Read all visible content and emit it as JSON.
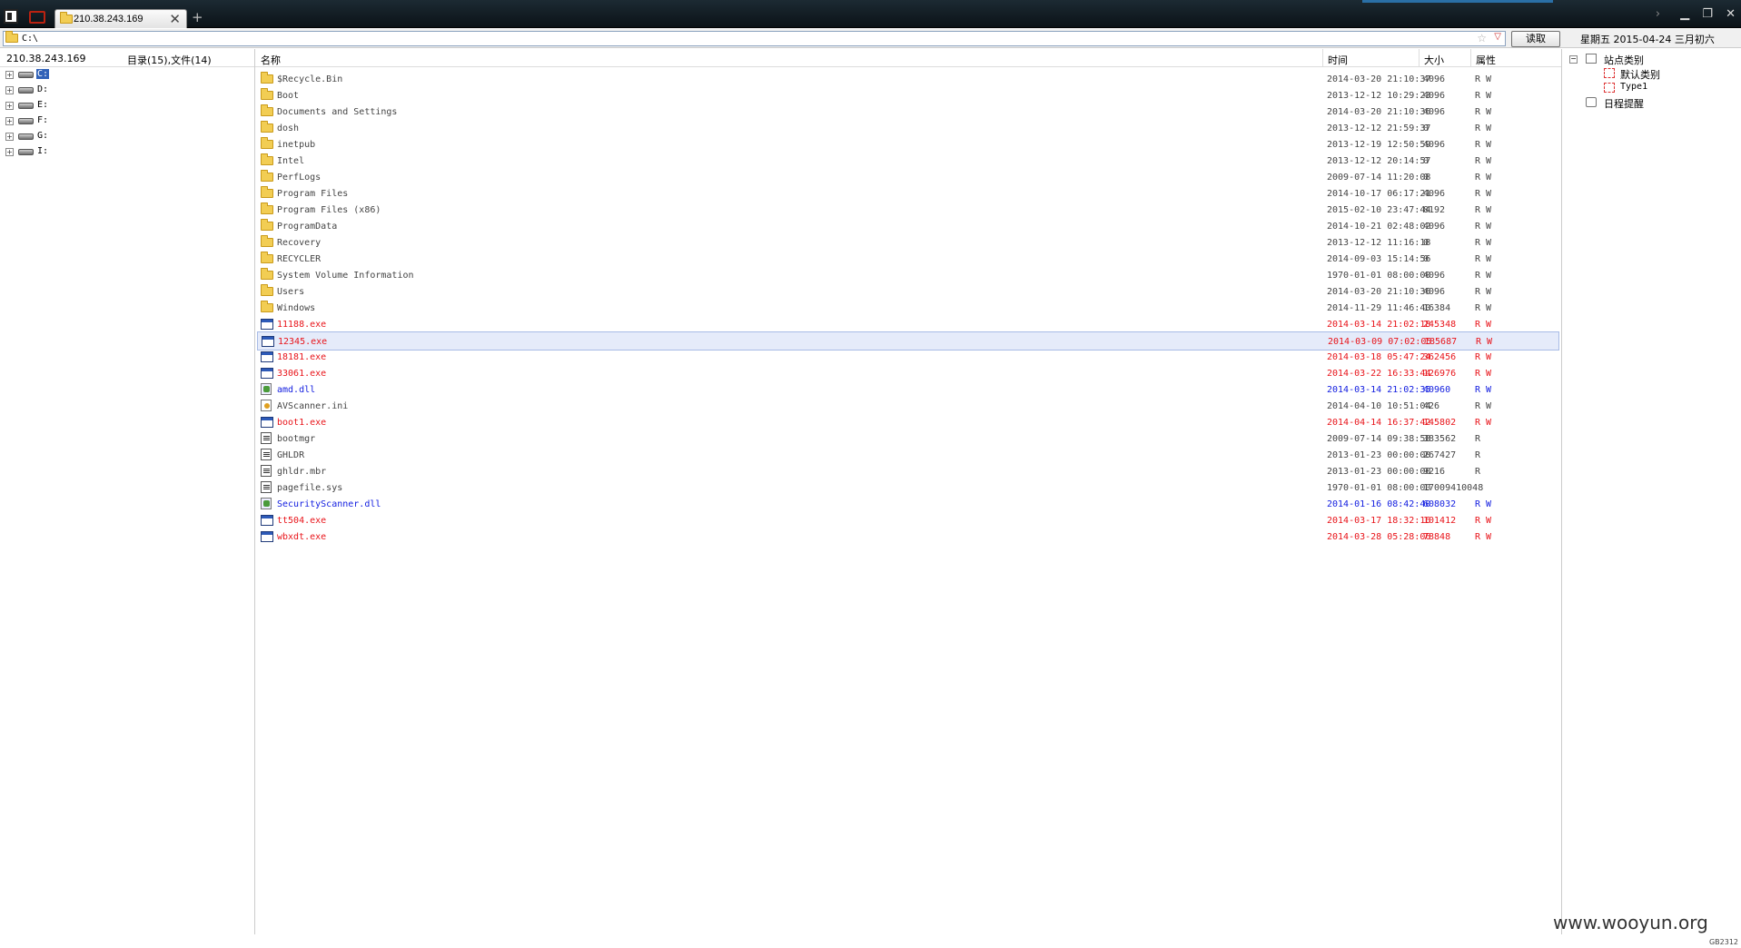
{
  "tab": {
    "title": "210.38.243.169"
  },
  "address": {
    "path": "C:\\",
    "read_button": "读取"
  },
  "date_info": "星期五 2015-04-24 三月初六",
  "left_panel": {
    "host": "210.38.243.169",
    "count": "目录(15),文件(14)",
    "drives": [
      "C:",
      "D:",
      "E:",
      "F:",
      "G:",
      "I:"
    ],
    "selected_drive": "C:"
  },
  "columns": {
    "name": "名称",
    "time": "时间",
    "size": "大小",
    "attr": "属性"
  },
  "files": [
    {
      "name": "$Recycle.Bin",
      "time": "2014-03-20 21:10:37",
      "size": "4096",
      "attr": "R W",
      "icon": "folder",
      "color": "black"
    },
    {
      "name": "Boot",
      "time": "2013-12-12 10:29:23",
      "size": "4096",
      "attr": "R W",
      "icon": "folder",
      "color": "black"
    },
    {
      "name": "Documents and Settings",
      "time": "2014-03-20 21:10:36",
      "size": "4096",
      "attr": "R W",
      "icon": "folder",
      "color": "black"
    },
    {
      "name": "dosh",
      "time": "2013-12-12 21:59:37",
      "size": "0",
      "attr": "R W",
      "icon": "folder",
      "color": "black"
    },
    {
      "name": "inetpub",
      "time": "2013-12-19 12:50:59",
      "size": "4096",
      "attr": "R W",
      "icon": "folder",
      "color": "black"
    },
    {
      "name": "Intel",
      "time": "2013-12-12 20:14:57",
      "size": "0",
      "attr": "R W",
      "icon": "folder",
      "color": "black"
    },
    {
      "name": "PerfLogs",
      "time": "2009-07-14 11:20:08",
      "size": "0",
      "attr": "R W",
      "icon": "folder",
      "color": "black"
    },
    {
      "name": "Program Files",
      "time": "2014-10-17 06:17:21",
      "size": "4096",
      "attr": "R W",
      "icon": "folder",
      "color": "black"
    },
    {
      "name": "Program Files (x86)",
      "time": "2015-02-10 23:47:44",
      "size": "8192",
      "attr": "R W",
      "icon": "folder",
      "color": "black"
    },
    {
      "name": "ProgramData",
      "time": "2014-10-21 02:48:02",
      "size": "4096",
      "attr": "R W",
      "icon": "folder",
      "color": "black"
    },
    {
      "name": "Recovery",
      "time": "2013-12-12 11:16:18",
      "size": "0",
      "attr": "R W",
      "icon": "folder",
      "color": "black"
    },
    {
      "name": "RECYCLER",
      "time": "2014-09-03 15:14:56",
      "size": "0",
      "attr": "R W",
      "icon": "folder",
      "color": "black"
    },
    {
      "name": "System Volume Information",
      "time": "1970-01-01 08:00:00",
      "size": "4096",
      "attr": "R W",
      "icon": "folder",
      "color": "black"
    },
    {
      "name": "Users",
      "time": "2014-03-20 21:10:36",
      "size": "4096",
      "attr": "R W",
      "icon": "folder",
      "color": "black"
    },
    {
      "name": "Windows",
      "time": "2014-11-29 11:46:40",
      "size": "16384",
      "attr": "R W",
      "icon": "folder",
      "color": "black"
    },
    {
      "name": "11188.exe",
      "time": "2014-03-14 21:02:18",
      "size": "245348",
      "attr": "R W",
      "icon": "exe",
      "color": "red"
    },
    {
      "name": "12345.exe",
      "time": "2014-03-09 07:02:05",
      "size": "185687",
      "attr": "R W",
      "icon": "exe",
      "color": "red",
      "selected": true
    },
    {
      "name": "18181.exe",
      "time": "2014-03-18 05:47:24",
      "size": "362456",
      "attr": "R W",
      "icon": "exe",
      "color": "red"
    },
    {
      "name": "33061.exe",
      "time": "2014-03-22 16:33:44",
      "size": "126976",
      "attr": "R W",
      "icon": "exe",
      "color": "red"
    },
    {
      "name": "amd.dll",
      "time": "2014-03-14 21:02:35",
      "size": "40960",
      "attr": "R W",
      "icon": "dll",
      "color": "blue"
    },
    {
      "name": "AVScanner.ini",
      "time": "2014-04-10 10:51:04",
      "size": "426",
      "attr": "R W",
      "icon": "ini",
      "color": "black"
    },
    {
      "name": "boot1.exe",
      "time": "2014-04-14 16:37:42",
      "size": "145802",
      "attr": "R W",
      "icon": "exe",
      "color": "red"
    },
    {
      "name": "bootmgr",
      "time": "2009-07-14 09:38:58",
      "size": "383562",
      "attr": "R",
      "icon": "sys",
      "color": "black"
    },
    {
      "name": "GHLDR",
      "time": "2013-01-23 00:00:00",
      "size": "267427",
      "attr": "R",
      "icon": "sys",
      "color": "black"
    },
    {
      "name": "ghldr.mbr",
      "time": "2013-01-23 00:00:00",
      "size": "9216",
      "attr": "R",
      "icon": "sys",
      "color": "black"
    },
    {
      "name": "pagefile.sys",
      "time": "1970-01-01 08:00:00",
      "size": "17009410048",
      "attr": "",
      "icon": "sys",
      "color": "black"
    },
    {
      "name": "SecurityScanner.dll",
      "time": "2014-01-16 08:42:40",
      "size": "608032",
      "attr": "R W",
      "icon": "dll",
      "color": "blue"
    },
    {
      "name": "tt504.exe",
      "time": "2014-03-17 18:32:16",
      "size": "101412",
      "attr": "R W",
      "icon": "exe",
      "color": "red"
    },
    {
      "name": "wbxdt.exe",
      "time": "2014-03-28 05:28:06",
      "size": "78848",
      "attr": "R W",
      "icon": "exe",
      "color": "red"
    }
  ],
  "right_panel": {
    "site_category": "站点类别",
    "default_category": "默认类别",
    "type1": "Type1",
    "schedule": "日程提醒"
  },
  "watermark": "www.wooyun.org",
  "encoding": "GB2312",
  "colors": {
    "red": "#e8141a",
    "blue": "#1520e0",
    "black": "#444444",
    "selection": "#e5ebfa"
  }
}
